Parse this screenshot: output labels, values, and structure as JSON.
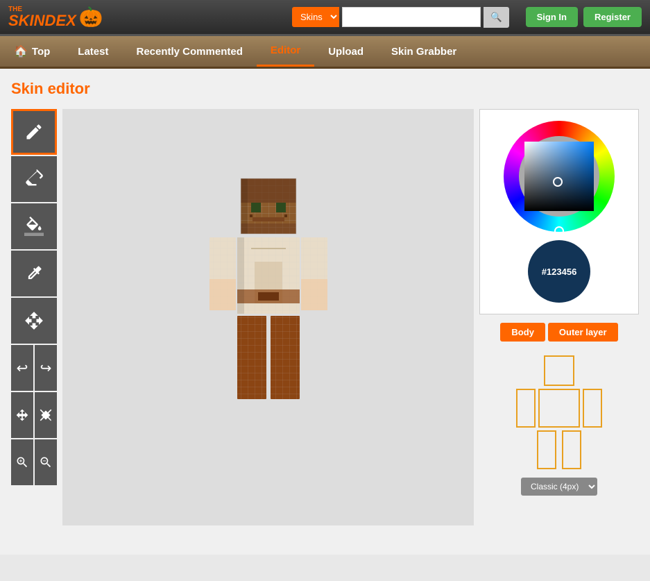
{
  "header": {
    "logo_the": "THE",
    "logo_name": "SKINDEX",
    "search_placeholder": "",
    "search_dropdown": "Skins",
    "signin_label": "Sign In",
    "register_label": "Register"
  },
  "nav": {
    "items": [
      {
        "id": "top",
        "label": "Top",
        "icon": "🏠",
        "active": false
      },
      {
        "id": "latest",
        "label": "Latest",
        "active": false
      },
      {
        "id": "recently-commented",
        "label": "Recently Commented",
        "active": false
      },
      {
        "id": "editor",
        "label": "Editor",
        "active": true
      },
      {
        "id": "upload",
        "label": "Upload",
        "active": false
      },
      {
        "id": "skin-grabber",
        "label": "Skin Grabber",
        "active": false
      }
    ]
  },
  "page": {
    "title": "Skin editor"
  },
  "toolbar": {
    "tools": [
      {
        "id": "pencil",
        "icon": "✏",
        "active": true
      },
      {
        "id": "eraser",
        "icon": "⬜",
        "active": false
      },
      {
        "id": "fill",
        "icon": "🪣",
        "active": false
      },
      {
        "id": "eyedropper",
        "icon": "💧",
        "active": false
      },
      {
        "id": "move",
        "icon": "↕",
        "active": false
      }
    ],
    "undo_label": "↩",
    "redo_label": "↪",
    "zoom_in_label": "🔍+",
    "zoom_out_label": "🔍-"
  },
  "color_picker": {
    "current_color": "#123456",
    "current_color_label": "#123456"
  },
  "layers": {
    "body_label": "Body",
    "outer_label": "Outer layer"
  },
  "skin_map": {
    "classic_label": "Classic (4px)"
  }
}
